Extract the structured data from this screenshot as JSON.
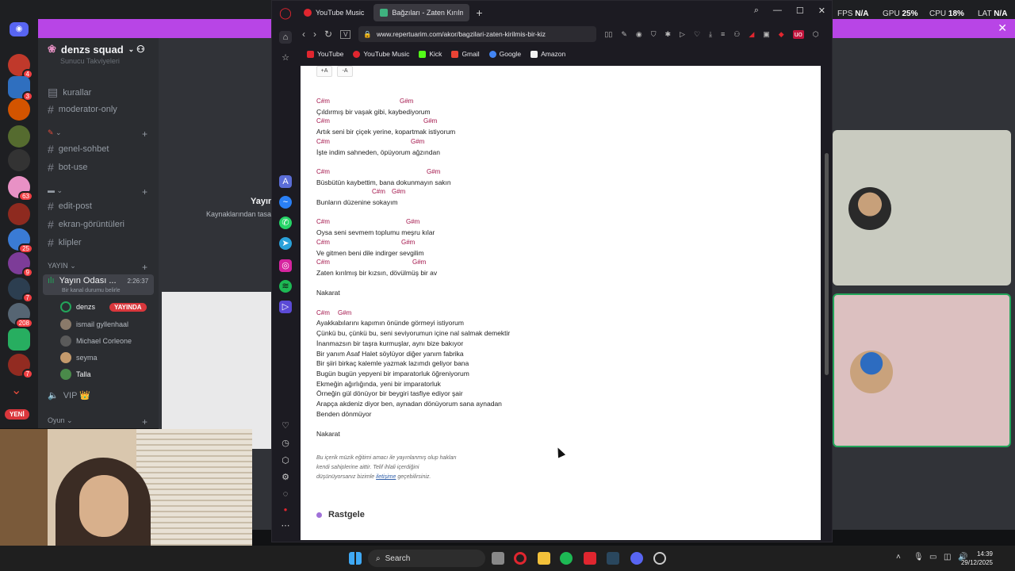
{
  "overlay": {
    "fps_label": "FPS",
    "fps_value": "N/A",
    "gpu_label": "GPU",
    "gpu_value": "25%",
    "cpu_label": "CPU",
    "cpu_value": "18%",
    "lat_label": "LAT",
    "lat_value": "N/A"
  },
  "discord": {
    "server_name": "denzs squad",
    "truncated_top": "Sunucu Takviyeleri",
    "channels": [
      {
        "name": "kurallar"
      },
      {
        "name": "moderator-only"
      },
      {
        "name": "genel-sohbet"
      },
      {
        "name": "bot-use"
      },
      {
        "name": "edit-post"
      },
      {
        "name": "ekran-görüntüleri"
      },
      {
        "name": "klipler"
      }
    ],
    "category_stream": "YAYIN",
    "voice_channel": "Yayın Odası ...",
    "voice_timer": "2:26:37",
    "voice_status": "Bir kanal durumu belirle",
    "members": [
      {
        "name": "denzs",
        "live": "YAYINDA"
      },
      {
        "name": "ismail gyllenhaal"
      },
      {
        "name": "Michael Corleone"
      },
      {
        "name": "seyma"
      },
      {
        "name": "Talla"
      }
    ],
    "vip_channel": "VIP 👑",
    "category_game": "Oyun",
    "new_badge": "YENİ",
    "main_title": "Yayın",
    "main_subtitle": "Kaynaklarından tasa",
    "server_badges": [
      "4",
      "3",
      "63",
      "25",
      "9",
      "7",
      "208",
      "7"
    ]
  },
  "browser": {
    "tabs": [
      {
        "label": "YouTube Music"
      },
      {
        "label": "Bağzıları - Zaten Kırılmış B"
      }
    ],
    "url": "www.repertuarim.com/akor/bagzilari-zaten-kirilmis-bir-kiz",
    "bookmarks": [
      "YouTube",
      "YouTube Music",
      "Kick",
      "Gmail",
      "Google",
      "Amazon"
    ],
    "font_up": "+A",
    "font_down": "-A"
  },
  "song": {
    "lines": [
      {
        "type": "chord",
        "parts": [
          {
            "t": "C#m",
            "o": 0
          },
          {
            "t": "G#m",
            "o": 105
          }
        ]
      },
      {
        "type": "lyric",
        "text": "Çıldırmış bir vaşak gibi, kaybediyorum"
      },
      {
        "type": "chord",
        "parts": [
          {
            "t": "C#m",
            "o": 0
          },
          {
            "t": "G#m",
            "o": 135
          }
        ]
      },
      {
        "type": "lyric",
        "text": "Artık seni bir çiçek yerine, kopartmak istiyorum"
      },
      {
        "type": "chord",
        "parts": [
          {
            "t": "C#m",
            "o": 0
          },
          {
            "t": "G#m",
            "o": 119
          }
        ]
      },
      {
        "type": "lyric",
        "text": "İşte indim sahneden, öpüyorum ağzından"
      },
      {
        "type": "gap"
      },
      {
        "type": "chord",
        "parts": [
          {
            "t": "C#m",
            "o": 0
          },
          {
            "t": "G#m",
            "o": 139
          }
        ]
      },
      {
        "type": "lyric",
        "text": "Büsbütün kaybettim, bana dokunmayın sakın"
      },
      {
        "type": "chord",
        "parts": [
          {
            "t": "C#m",
            "o": 70
          },
          {
            "t": "G#m",
            "o": 95
          }
        ]
      },
      {
        "type": "lyric",
        "text": "Bunların düzenine sokayım"
      },
      {
        "type": "gap"
      },
      {
        "type": "chord",
        "parts": [
          {
            "t": "C#m",
            "o": 0
          },
          {
            "t": "G#m",
            "o": 113
          }
        ]
      },
      {
        "type": "lyric",
        "text": "Oysa seni sevmem toplumu meşru kılar"
      },
      {
        "type": "chord",
        "parts": [
          {
            "t": "C#m",
            "o": 0
          },
          {
            "t": "G#m",
            "o": 107
          }
        ]
      },
      {
        "type": "lyric",
        "text": "Ve gitmen beni dile indirger sevgilim"
      },
      {
        "type": "chord",
        "parts": [
          {
            "t": "C#m",
            "o": 0
          },
          {
            "t": "G#m",
            "o": 121
          }
        ]
      },
      {
        "type": "lyric",
        "text": "Zaten kırılmış bir kızsın, dövülmüş bir av"
      },
      {
        "type": "gap"
      },
      {
        "type": "lyric",
        "text": "Nakarat"
      },
      {
        "type": "gap"
      },
      {
        "type": "chord",
        "parts": [
          {
            "t": "C#m",
            "o": 0
          },
          {
            "t": "G#m",
            "o": 27
          }
        ]
      },
      {
        "type": "lyric",
        "text": "Ayakkabılarını kapımın önünde görmeyi istiyorum"
      },
      {
        "type": "lyric",
        "text": "Çünkü bu, çünkü bu, seni seviyorumun içine nal salmak demektir"
      },
      {
        "type": "lyric",
        "text": "İnanmazsın bir taşra kurmuşlar, aynı bize bakıyor"
      },
      {
        "type": "lyric",
        "text": "Bir yanım Asaf Halet söylüyor diğer yanım fabrika"
      },
      {
        "type": "lyric",
        "text": "Bir şiiri birkaç kalemle yazmak lazımdı geliyor bana"
      },
      {
        "type": "lyric",
        "text": "Bugün bugün yepyeni bir imparatorluk öğreniyorum"
      },
      {
        "type": "lyric",
        "text": "Ekmeğin ağırlığında, yeni bir imparatorluk"
      },
      {
        "type": "lyric",
        "text": "Örneğin gül dönüyor bir beygiri tasfiye ediyor şair"
      },
      {
        "type": "lyric",
        "text": "Arapça akdeniz diyor ben, aynadan dönüyorum sana aynadan"
      },
      {
        "type": "lyric",
        "text": "Benden dönmüyor"
      },
      {
        "type": "gap"
      },
      {
        "type": "lyric",
        "text": "Nakarat"
      }
    ],
    "disclaimer_1": "Bu içerik müzik eğitimi amacı ile yayınlanmış olup hakları",
    "disclaimer_2": "kendi sahiplerine aittir. Telif ihlali içerdiğini",
    "disclaimer_3a": "düşünüyorsanız bizimle",
    "disclaimer_link": "iletişime",
    "disclaimer_3b": "geçebilirsiniz.",
    "random_heading": "Rastgele"
  },
  "taskbar": {
    "search_label": "Search",
    "time": "14:39",
    "date": "29/12/2025"
  },
  "colors": {
    "chord": "#a3144a",
    "discord_accent": "#b845e6",
    "live_red": "#da373c"
  }
}
